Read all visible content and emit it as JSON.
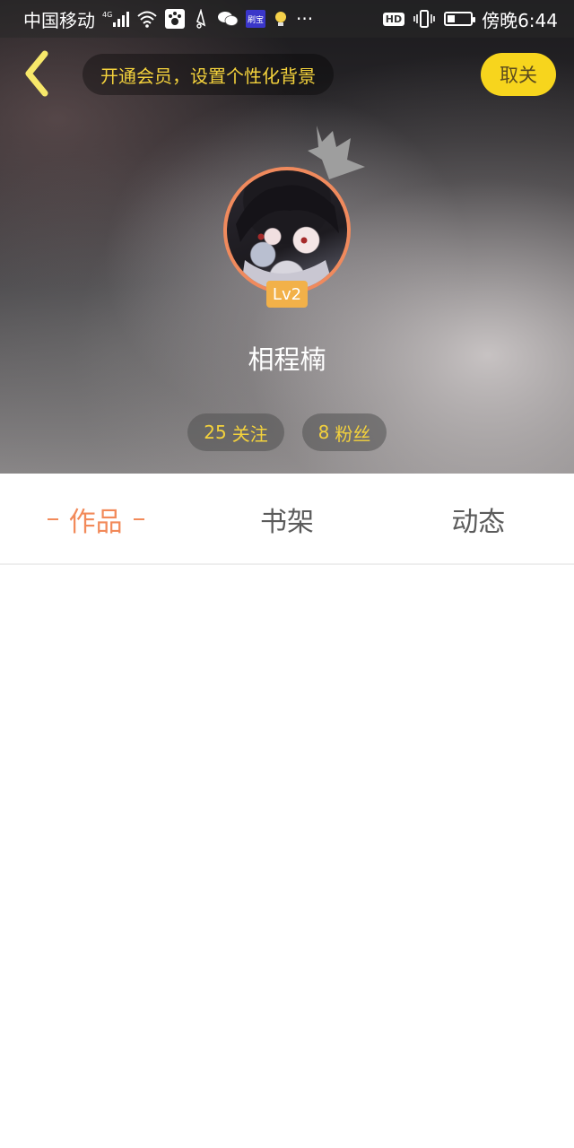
{
  "status_bar": {
    "carrier": "中国移动",
    "network": "4G",
    "app_badge_text": "刷宝",
    "hd_label": "HD",
    "time": "傍晚6:44",
    "more": "···"
  },
  "header": {
    "member_prompt": "开通会员，设置个性化背景",
    "cancel_label": "取关"
  },
  "profile": {
    "level": "Lv2",
    "name": "相程楠",
    "following_count": "25",
    "following_label": "关注",
    "fans_count": "8",
    "fans_label": "粉丝"
  },
  "tabs": [
    {
      "label": "作品",
      "active": true
    },
    {
      "label": "书架",
      "active": false
    },
    {
      "label": "动态",
      "active": false
    }
  ],
  "colors": {
    "accent_orange": "#f28a5a",
    "accent_yellow": "#f7d51d",
    "level_badge": "#f2b149"
  },
  "icons": [
    "signal-icon",
    "wifi-icon",
    "paw-app-icon",
    "notification-icon",
    "wechat-icon",
    "bulb-icon",
    "vibrate-icon",
    "battery-icon",
    "back-chevron-icon",
    "crown-icon"
  ]
}
